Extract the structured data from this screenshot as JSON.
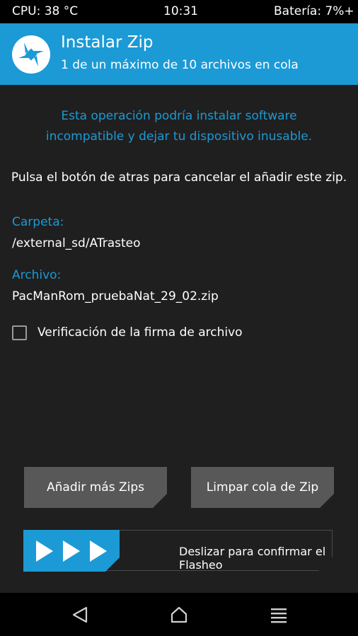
{
  "status_bar": {
    "cpu": "CPU: 38 °C",
    "time": "10:31",
    "battery": "Batería: 7%+"
  },
  "header": {
    "title": "Instalar Zip",
    "subtitle": "1 de un máximo de 10 archivos en cola",
    "logo_icon": "twrp-logo-icon"
  },
  "warning": {
    "line1": "Esta operación podría instalar software",
    "line2": "incompatible y dejar tu dispositivo inusable."
  },
  "back_note": "Pulsa el botón de atras para cancelar el añadir este zip.",
  "folder": {
    "label": "Carpeta:",
    "value": "/external_sd/ATrasteo"
  },
  "file": {
    "label": "Archivo:",
    "value": "PacManRom_pruebaNat_29_02.zip"
  },
  "signature_check": {
    "label": "Verificación de la firma de archivo",
    "checked": false
  },
  "buttons": {
    "add_more": "Añadir más Zips",
    "clear_queue": "Limpar cola de Zip"
  },
  "slider": {
    "label": "Deslizar para confirmar el Flasheo"
  },
  "navbar": {
    "back_icon": "back-triangle-icon",
    "home_icon": "home-icon",
    "menu_icon": "menu-icon"
  },
  "colors": {
    "accent": "#1b9ad6",
    "background": "#1f1f1f",
    "button": "#585858"
  }
}
